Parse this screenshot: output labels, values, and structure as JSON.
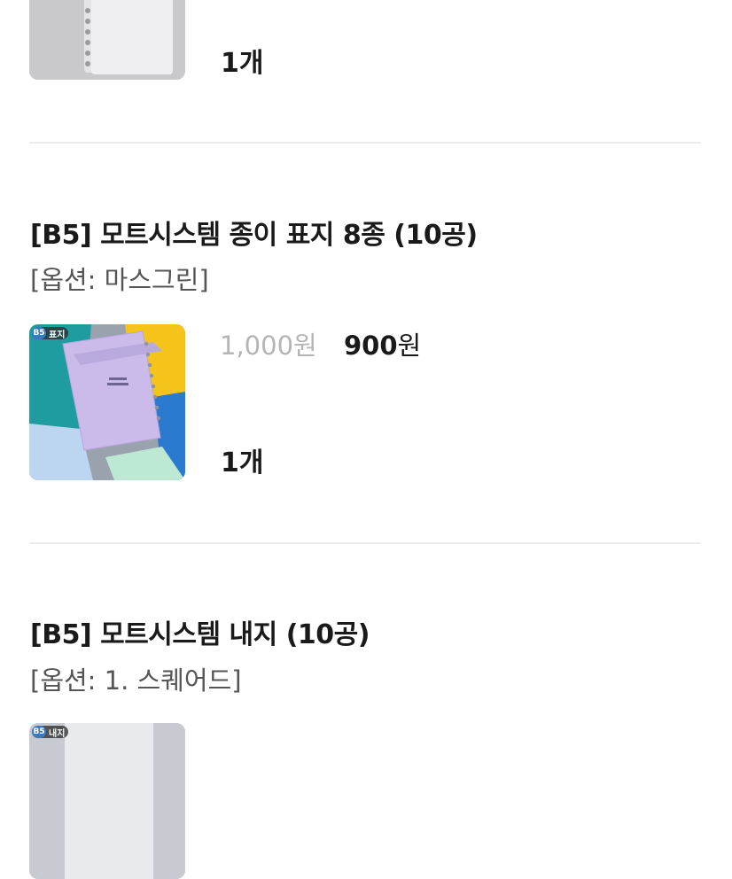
{
  "items": [
    {
      "quantity": "1개"
    },
    {
      "title": "[B5] 모트시스템 종이 표지 8종 (10공)",
      "option": "[옵션: 마스그린]",
      "badge": {
        "size": "B5",
        "label": "표지"
      },
      "original_price": "1,000원",
      "sale_price_number": "900",
      "sale_price_unit": "원",
      "quantity": "1개"
    },
    {
      "title": "[B5] 모트시스템 내지 (10공)",
      "option": "[옵션: 1. 스퀘어드]",
      "badge": {
        "size": "B5",
        "label": "내지"
      }
    }
  ]
}
